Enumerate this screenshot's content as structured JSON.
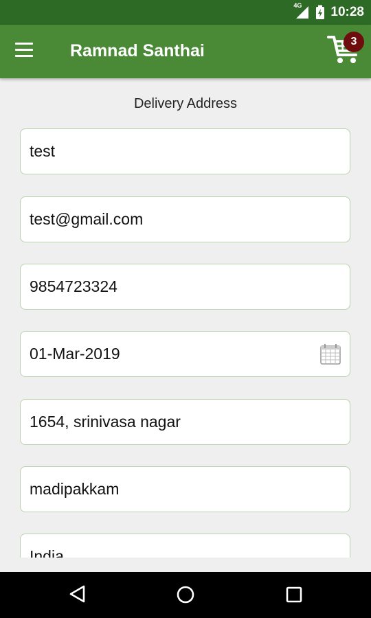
{
  "status_bar": {
    "network": "4G",
    "time": "10:28"
  },
  "app_bar": {
    "title": "Ramnad Santhai",
    "cart_count": "3"
  },
  "form": {
    "heading": "Delivery Address",
    "name": "test",
    "email": "test@gmail.com",
    "phone": "9854723324",
    "date": "01-Mar-2019",
    "address": "1654, srinivasa nagar",
    "area": "madipakkam",
    "country": "India"
  },
  "colors": {
    "status_bar": "#2d6a25",
    "app_bar": "#4a8a36",
    "badge": "#6e0d0d",
    "field_border": "#b8d3ad"
  },
  "icons": [
    "menu-icon",
    "cart-icon",
    "calendar-icon",
    "back-icon",
    "home-icon",
    "recents-icon"
  ]
}
